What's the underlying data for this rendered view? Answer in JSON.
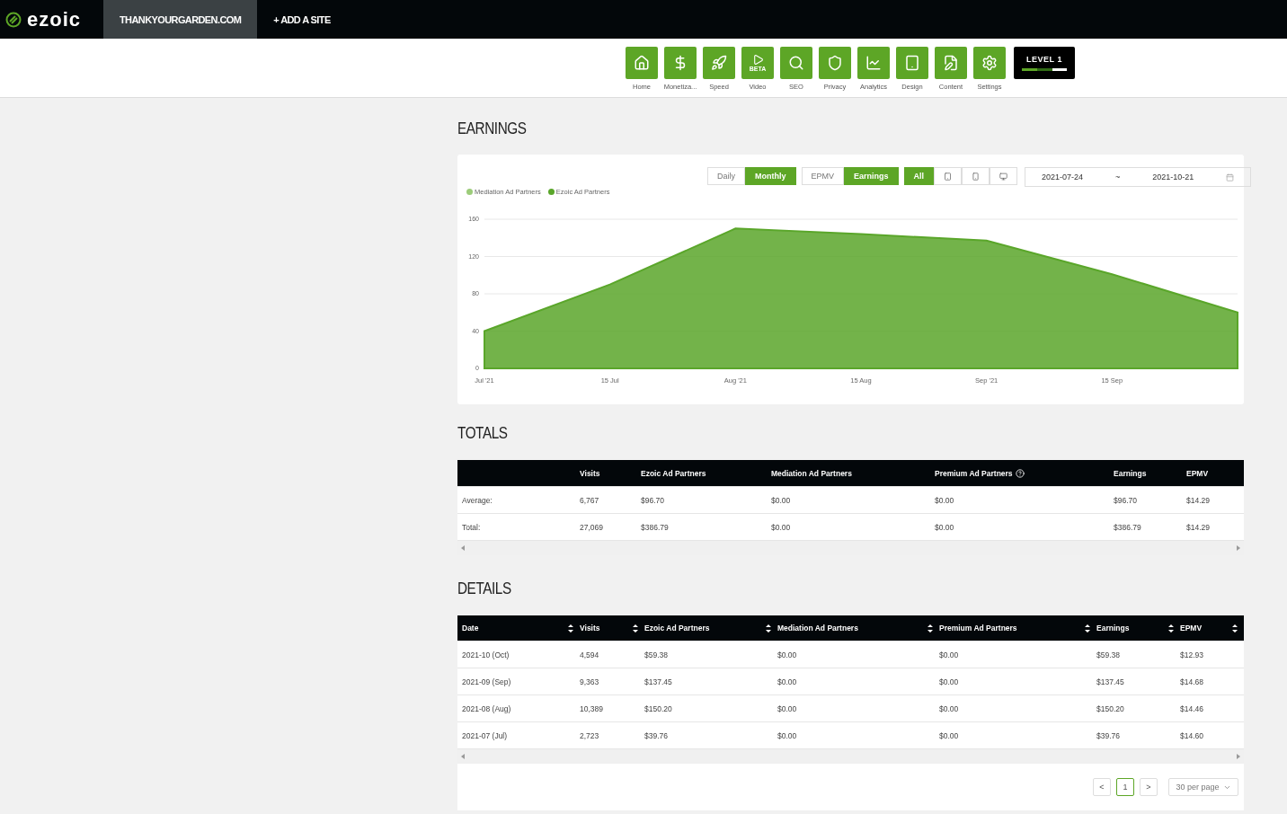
{
  "header": {
    "logo": "ezoic",
    "sites": [
      {
        "label": "THANKYOURGARDEN.COM",
        "selected": true
      },
      {
        "label": "+ ADD A SITE",
        "selected": false
      }
    ]
  },
  "nav": {
    "items": [
      {
        "label": "Home"
      },
      {
        "label": "Monetiza..."
      },
      {
        "label": "Speed"
      },
      {
        "label": "Video",
        "badge": "BETA"
      },
      {
        "label": "SEO"
      },
      {
        "label": "Privacy"
      },
      {
        "label": "Analytics"
      },
      {
        "label": "Design"
      },
      {
        "label": "Content"
      },
      {
        "label": "Settings"
      }
    ],
    "level": {
      "label": "LEVEL 1",
      "level": 0.67
    }
  },
  "earnings": {
    "title": "EARNINGS",
    "granularity": [
      {
        "label": "Daily",
        "selected": false
      },
      {
        "label": "Monthly",
        "selected": true
      }
    ],
    "metric": [
      {
        "label": "EPMV",
        "selected": false
      },
      {
        "label": "Earnings",
        "selected": true
      }
    ],
    "devices": [
      {
        "kind": "text",
        "label": "All",
        "selected": true
      },
      {
        "kind": "tablet",
        "selected": false
      },
      {
        "kind": "mobile",
        "selected": false
      },
      {
        "kind": "desktop",
        "selected": false
      }
    ],
    "date_range": {
      "start": "2021-07-24",
      "separator": "~",
      "end": "2021-10-21"
    },
    "chart_data": {
      "type": "area",
      "categories": [
        "Jul '21",
        "15 Jul",
        "Aug '21",
        "15 Aug",
        "Sep '21",
        "15 Sep",
        null
      ],
      "series": [
        {
          "name": "Mediation Ad Partners",
          "color": "#9ccc7a",
          "values": [
            null,
            null,
            null,
            null,
            null,
            null,
            null
          ]
        },
        {
          "name": "Ezoic Ad Partners",
          "color": "#5aa62a",
          "values": [
            40,
            90,
            150,
            144,
            137,
            101,
            60
          ]
        }
      ],
      "ylim": [
        0,
        160
      ],
      "yticks": [
        0,
        40,
        80,
        120,
        160
      ]
    }
  },
  "totals": {
    "title": "TOTALS",
    "columns": [
      {},
      {
        "label": "Visits"
      },
      {
        "label": "Ezoic Ad Partners"
      },
      {
        "label": "Mediation Ad Partners"
      },
      {
        "label": "Premium Ad Partners",
        "help": true
      },
      {
        "label": "Earnings"
      },
      {
        "label": "EPMV"
      }
    ],
    "rows": [
      [
        "Average:",
        "6,767",
        "$96.70",
        "$0.00",
        "$0.00",
        "$96.70",
        "$14.29"
      ],
      [
        "Total:",
        "27,069",
        "$386.79",
        "$0.00",
        "$0.00",
        "$386.79",
        "$14.29"
      ]
    ]
  },
  "details": {
    "title": "DETAILS",
    "columns": [
      "Date",
      "Visits",
      "Ezoic Ad Partners",
      "Mediation Ad Partners",
      "Premium Ad Partners",
      "Earnings",
      "EPMV"
    ],
    "rows": [
      [
        "2021-10 (Oct)",
        "4,594",
        "$59.38",
        "$0.00",
        "$0.00",
        "$59.38",
        "$12.93"
      ],
      [
        "2021-09 (Sep)",
        "9,363",
        "$137.45",
        "$0.00",
        "$0.00",
        "$137.45",
        "$14.68"
      ],
      [
        "2021-08 (Aug)",
        "10,389",
        "$150.20",
        "$0.00",
        "$0.00",
        "$150.20",
        "$14.46"
      ],
      [
        "2021-07 (Jul)",
        "2,723",
        "$39.76",
        "$0.00",
        "$0.00",
        "$39.76",
        "$14.60"
      ]
    ],
    "pagination": {
      "prev": "<",
      "pages": [
        {
          "label": "1",
          "selected": true
        }
      ],
      "next": ">",
      "per_page": "30 per page"
    }
  }
}
